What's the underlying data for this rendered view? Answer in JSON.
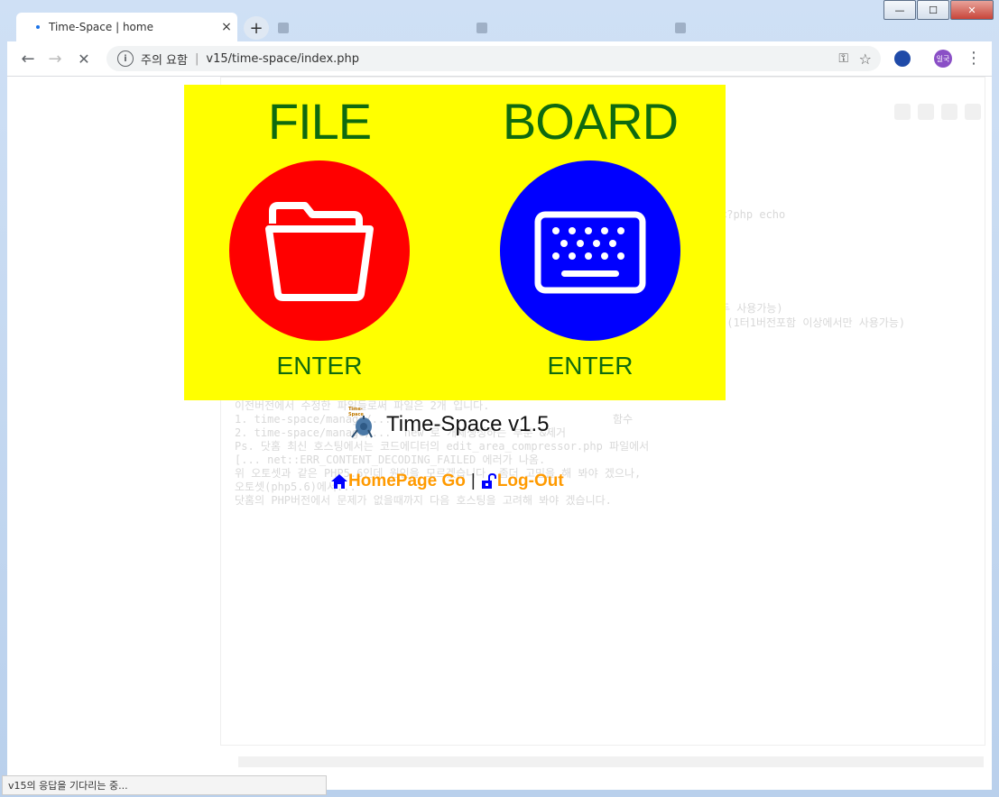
{
  "window": {
    "minimize_label": "—",
    "maximize_label": "☐",
    "close_label": "✕"
  },
  "tabs": {
    "active_title": "Time-Space | home",
    "close_symbol": "×",
    "new_tab_symbol": "+"
  },
  "toolbar": {
    "back_symbol": "←",
    "forward_symbol": "→",
    "reload_symbol": "✕",
    "security_text": "주의 요함",
    "url": "v15/time-space/index.php",
    "profile_text": "일국",
    "menu_symbol": "⋮"
  },
  "page": {
    "file_block": {
      "heading": "FILE",
      "enter_label": "ENTER",
      "color": "#ff0000",
      "icon": "folder-icon"
    },
    "board_block": {
      "heading": "BOARD",
      "enter_label": "ENTER",
      "color": "#0000ff",
      "icon": "keyboard-icon"
    },
    "hero_background": "#ffff00",
    "logo_label": "Time-Space",
    "version_text": "Time-Space v1.5",
    "homepage_link": "HomePage Go",
    "separator": "|",
    "logout_link": "Log-Out",
    "link_color": "#ff9a00"
  },
  "background_text": {
    "line1": "<?php echo",
    "line2": "두 사용가능)",
    "line3": ".(1터1버전포함 이상에서만 사용가능)",
    "line4": "이전버전에서 수정한 파일들로써 파일은 2개 입니다.",
    "line5": "1. time-space/manage/...                                  함수",
    "line6": "2. time-space/manage/...  new 로 개체생성하는 부분 &제거",
    "line7": "Ps. 닷홈 최신 호스팅에서는 코드에디터의 edit_area_compressor.php 파일에서",
    "line8": "[... net::ERR_CONTENT_DECODING_FAILED 에러가 나옴.",
    "line9": "위 오토셋과 같은 PHP5.6인데 원인을 모르겠습니다. 좀더 고민을 해 봐야 겠으나,",
    "line10": "오토셋(php5.6)에서...",
    "line11": "닷홈의 PHP버전에서 문제가 없을때까지 다음 호스팅을 고려해 봐야 겠습니다."
  },
  "status_bar": {
    "text": "v15의 응답을 기다리는 중..."
  }
}
